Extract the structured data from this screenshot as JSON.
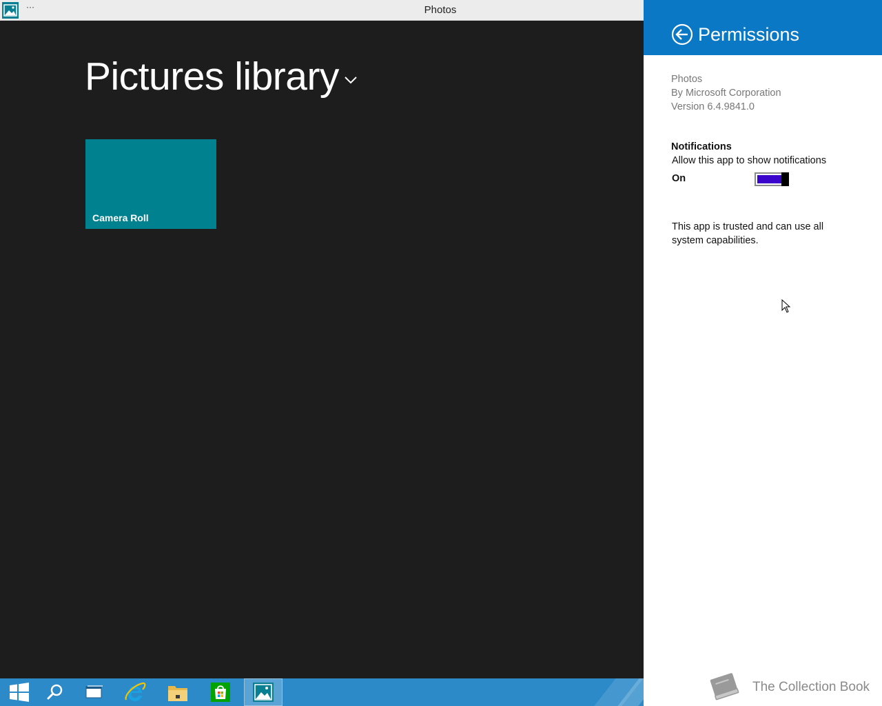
{
  "window": {
    "title": "Photos",
    "more_menu": "···"
  },
  "main": {
    "heading": "Pictures library",
    "tiles": [
      {
        "label": "Camera Roll",
        "color": "#00818f"
      }
    ]
  },
  "taskbar": {
    "color": "#2c8ac9",
    "items": [
      {
        "icon": "windows-start-icon"
      },
      {
        "icon": "search-icon"
      },
      {
        "icon": "task-view-icon"
      },
      {
        "icon": "internet-explorer-icon"
      },
      {
        "icon": "file-explorer-icon"
      },
      {
        "icon": "store-icon"
      },
      {
        "icon": "photos-icon",
        "active": true
      }
    ]
  },
  "flyout": {
    "title": "Permissions",
    "header_color": "#0a78c4",
    "app_name": "Photos",
    "publisher": "By Microsoft Corporation",
    "version": "Version 6.4.9841.0",
    "notifications": {
      "heading": "Notifications",
      "description": "Allow this app to show notifications",
      "state_label": "On",
      "enabled": true,
      "toggle_color": "#3a04cc"
    },
    "trusted_text": "This app is trusted and can use all system capabilities.",
    "watermark": "The Collection Book"
  }
}
